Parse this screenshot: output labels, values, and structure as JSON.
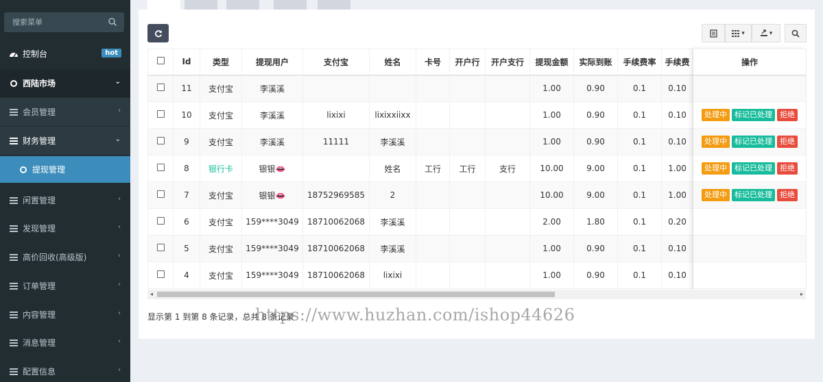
{
  "sidebar": {
    "search_placeholder": "搜索菜单",
    "dashboard": "控制台",
    "hot_badge": "hot",
    "market": "西陆市场",
    "items": [
      {
        "label": "会员管理",
        "icon": "list-icon"
      },
      {
        "label": "财务管理",
        "icon": "list-icon"
      },
      {
        "label": "提现管理",
        "icon": "circle-icon"
      },
      {
        "label": "闲置管理",
        "icon": "list-icon"
      },
      {
        "label": "发现管理",
        "icon": "list-icon"
      },
      {
        "label": "高价回收(高级版)",
        "icon": "list-icon"
      },
      {
        "label": "订单管理",
        "icon": "list-icon"
      },
      {
        "label": "内容管理",
        "icon": "list-icon"
      },
      {
        "label": "消息管理",
        "icon": "list-icon"
      },
      {
        "label": "配置信息",
        "icon": "list-icon"
      }
    ]
  },
  "table": {
    "headers": [
      "Id",
      "类型",
      "提现用户",
      "支付宝",
      "姓名",
      "卡号",
      "开户行",
      "开户支行",
      "提现金额",
      "实际到账",
      "手续费率",
      "手续费",
      "操作"
    ],
    "rows": [
      {
        "id": "11",
        "type": "支付宝",
        "user": "李溪溪",
        "alipay": "",
        "name": "",
        "card": "",
        "bank": "",
        "branch": "",
        "amount": "1.00",
        "actual": "0.90",
        "rate": "0.1",
        "fee": "0.10",
        "ops": false
      },
      {
        "id": "10",
        "type": "支付宝",
        "user": "李溪溪",
        "alipay": "lixixi",
        "name": "lixixxiixx",
        "card": "",
        "bank": "",
        "branch": "",
        "amount": "1.00",
        "actual": "0.90",
        "rate": "0.1",
        "fee": "0.10",
        "ops": true
      },
      {
        "id": "9",
        "type": "支付宝",
        "user": "李溪溪",
        "alipay": "11111",
        "name": "李溪溪",
        "card": "",
        "bank": "",
        "branch": "",
        "amount": "1.00",
        "actual": "0.90",
        "rate": "0.1",
        "fee": "0.10",
        "ops": true
      },
      {
        "id": "8",
        "type": "银行卡",
        "user": "银银👄",
        "alipay": "",
        "name": "姓名",
        "card": "工行",
        "bank": "工行",
        "branch": "支行",
        "amount": "10.00",
        "actual": "9.00",
        "rate": "0.1",
        "fee": "1.00",
        "ops": true
      },
      {
        "id": "7",
        "type": "支付宝",
        "user": "银银👄",
        "alipay": "18752969585",
        "name": "2",
        "card": "",
        "bank": "",
        "branch": "",
        "amount": "10.00",
        "actual": "9.00",
        "rate": "0.1",
        "fee": "1.00",
        "ops": true
      },
      {
        "id": "6",
        "type": "支付宝",
        "user": "159****3049",
        "alipay": "18710062068",
        "name": "李溪溪",
        "card": "",
        "bank": "",
        "branch": "",
        "amount": "2.00",
        "actual": "1.80",
        "rate": "0.1",
        "fee": "0.20",
        "ops": false
      },
      {
        "id": "5",
        "type": "支付宝",
        "user": "159****3049",
        "alipay": "18710062068",
        "name": "李溪溪",
        "card": "",
        "bank": "",
        "branch": "",
        "amount": "1.00",
        "actual": "0.90",
        "rate": "0.1",
        "fee": "0.10",
        "ops": false
      },
      {
        "id": "4",
        "type": "支付宝",
        "user": "159****3049",
        "alipay": "18710062068",
        "name": "lixixi",
        "card": "",
        "bank": "",
        "branch": "",
        "amount": "1.00",
        "actual": "0.90",
        "rate": "0.1",
        "fee": "0.10",
        "ops": false
      }
    ],
    "op_labels": {
      "processing": "处理中",
      "mark_done": "标记已处理",
      "reject": "拒绝"
    }
  },
  "footer": {
    "summary": "显示第 1 到第 8 条记录，总共 8 条记录"
  },
  "watermark": "https://www.huzhan.com/ishop44626",
  "colors": {
    "sidebar_bg": "#222d32",
    "active": "#3c8dbc",
    "orange": "#f39c12",
    "teal": "#18bc9c",
    "red": "#e74c3c"
  }
}
